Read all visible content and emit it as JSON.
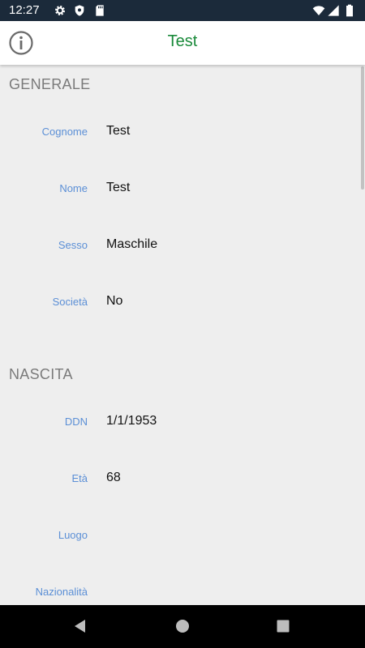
{
  "status_bar": {
    "time": "12:27",
    "left_icons": [
      "settings-icon",
      "shield-icon",
      "sd-card-icon"
    ],
    "right_icons": [
      "wifi-icon",
      "signal-icon",
      "battery-icon"
    ]
  },
  "app_bar": {
    "title": "Test",
    "title_color": "#1a8a3a",
    "info_icon": "info-icon"
  },
  "sections": {
    "generale": {
      "title": "GENERALE",
      "fields": {
        "cognome": {
          "label": "Cognome",
          "value": "Test"
        },
        "nome": {
          "label": "Nome",
          "value": "Test"
        },
        "sesso": {
          "label": "Sesso",
          "value": "Maschile"
        },
        "societa": {
          "label": "Società",
          "value": "No"
        }
      }
    },
    "nascita": {
      "title": "NASCITA",
      "fields": {
        "ddn": {
          "label": "DDN",
          "value": "1/1/1953"
        },
        "eta": {
          "label": "Età",
          "value": "68"
        },
        "luogo": {
          "label": "Luogo",
          "value": ""
        },
        "nazionalita": {
          "label": "Nazionalità",
          "value": ""
        }
      }
    }
  },
  "colors": {
    "label": "#5b8fd6",
    "section_header": "#7a7a7a",
    "background": "#eeeeee",
    "status_bar": "#1b2a3a"
  },
  "nav_bar": {
    "buttons": [
      "back-icon",
      "home-icon",
      "recents-icon"
    ]
  }
}
